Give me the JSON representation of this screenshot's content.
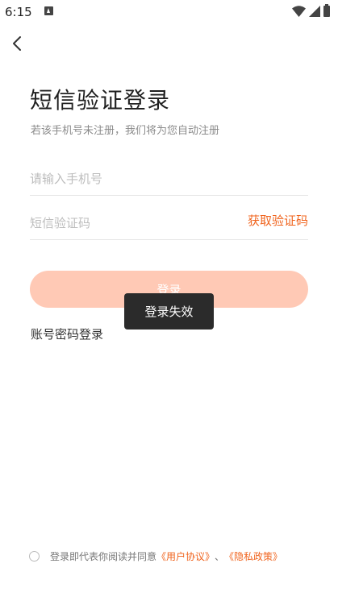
{
  "status_bar": {
    "time": "6:15"
  },
  "page": {
    "title": "短信验证登录",
    "subtitle": "若该手机号未注册，我们将为您自动注册"
  },
  "form": {
    "phone_placeholder": "请输入手机号",
    "phone_value": "",
    "code_placeholder": "短信验证码",
    "code_value": "",
    "get_code_label": "获取验证码",
    "login_label": "登录",
    "account_login_label": "账号密码登录"
  },
  "toast": {
    "message": "登录失效"
  },
  "agreement": {
    "prefix": "登录即代表你阅读并同意",
    "user_agreement": "《用户协议》",
    "separator": "、",
    "privacy_policy": "《隐私政策》"
  },
  "colors": {
    "accent": "#f0641e",
    "button_disabled": "#ffc9b5",
    "toast_bg": "#2b2b2b"
  }
}
